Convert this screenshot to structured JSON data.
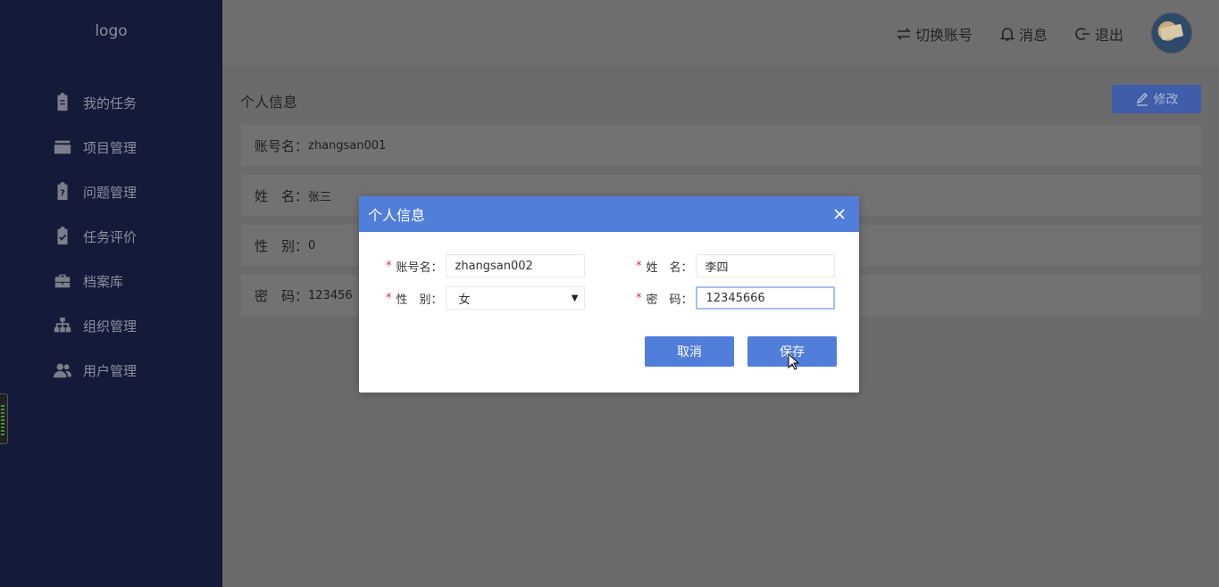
{
  "sidebar": {
    "logo": "logo",
    "items": [
      {
        "label": "我的任务",
        "icon": "clipboard-icon"
      },
      {
        "label": "项目管理",
        "icon": "folder-icon"
      },
      {
        "label": "问题管理",
        "icon": "question-clipboard-icon"
      },
      {
        "label": "任务评价",
        "icon": "check-clipboard-icon"
      },
      {
        "label": "档案库",
        "icon": "briefcase-icon"
      },
      {
        "label": "组织管理",
        "icon": "org-chart-icon"
      },
      {
        "label": "用户管理",
        "icon": "users-icon"
      }
    ]
  },
  "header": {
    "switch_account": "切换账号",
    "messages": "消息",
    "logout": "退出"
  },
  "content": {
    "title": "个人信息",
    "edit_label": "修改",
    "rows": [
      {
        "label": "账号名：",
        "value": "zhangsan001"
      },
      {
        "label": "姓　名：",
        "value": "张三"
      },
      {
        "label": "性　别：",
        "value": "0"
      },
      {
        "label": "密　码：",
        "value": "123456"
      }
    ]
  },
  "modal": {
    "title": "个人信息",
    "fields": {
      "account": {
        "label": "账号名：",
        "value": "zhangsan002"
      },
      "name": {
        "label": "姓　名：",
        "value": "李四"
      },
      "gender": {
        "label": "性　别：",
        "value": "女"
      },
      "password": {
        "label": "密　码：",
        "value": "12345666"
      }
    },
    "cancel_label": "取消",
    "save_label": "保存"
  },
  "colors": {
    "sidebar_bg": "#131a3a",
    "primary": "#517edb",
    "required": "#e0302f"
  }
}
